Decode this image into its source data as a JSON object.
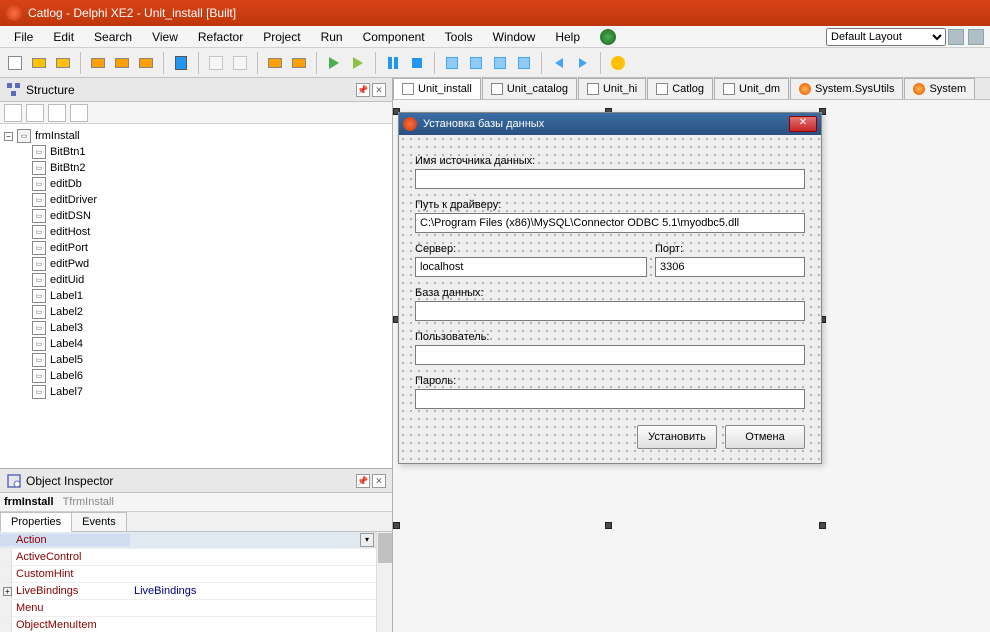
{
  "title": "Catlog - Delphi XE2 - Unit_install [Built]",
  "menu": [
    "File",
    "Edit",
    "Search",
    "View",
    "Refactor",
    "Project",
    "Run",
    "Component",
    "Tools",
    "Window",
    "Help"
  ],
  "layout": {
    "selected": "Default Layout"
  },
  "structure": {
    "title": "Structure",
    "root": "frmInstall",
    "children": [
      "BitBtn1",
      "BitBtn2",
      "editDb",
      "editDriver",
      "editDSN",
      "editHost",
      "editPort",
      "editPwd",
      "editUid",
      "Label1",
      "Label2",
      "Label3",
      "Label4",
      "Label5",
      "Label6",
      "Label7"
    ]
  },
  "inspector": {
    "title": "Object Inspector",
    "objName": "frmInstall",
    "objClass": "TfrmInstall",
    "tabs": [
      "Properties",
      "Events"
    ],
    "activeTab": 0,
    "props": [
      {
        "name": "Action",
        "value": "",
        "sel": true,
        "combo": true
      },
      {
        "name": "ActiveControl",
        "value": ""
      },
      {
        "name": "CustomHint",
        "value": ""
      },
      {
        "name": "LiveBindings",
        "value": "LiveBindings",
        "exp": true
      },
      {
        "name": "Menu",
        "value": ""
      },
      {
        "name": "ObjectMenuItem",
        "value": ""
      }
    ]
  },
  "editorTabs": [
    {
      "label": "Unit_install",
      "active": true,
      "icon": "unit"
    },
    {
      "label": "Unit_catalog",
      "icon": "unit"
    },
    {
      "label": "Unit_hi",
      "icon": "unit"
    },
    {
      "label": "Catlog",
      "icon": "unit"
    },
    {
      "label": "Unit_dm",
      "icon": "unit"
    },
    {
      "label": "System.SysUtils",
      "icon": "sys"
    },
    {
      "label": "System",
      "icon": "sys"
    }
  ],
  "form": {
    "caption": "Установка базы данных",
    "labels": {
      "dsn": "Имя источника данных:",
      "driver": "Путь к драйверу:",
      "server": "Сервер:",
      "port": "Порт:",
      "db": "База данных:",
      "user": "Пользователь:",
      "pwd": "Пароль:"
    },
    "values": {
      "dsn": "",
      "driver": "C:\\Program Files (x86)\\MySQL\\Connector ODBC 5.1\\myodbc5.dll",
      "server": "localhost",
      "port": "3306",
      "db": "",
      "user": "",
      "pwd": ""
    },
    "buttons": {
      "ok": "Установить",
      "cancel": "Отмена"
    }
  }
}
